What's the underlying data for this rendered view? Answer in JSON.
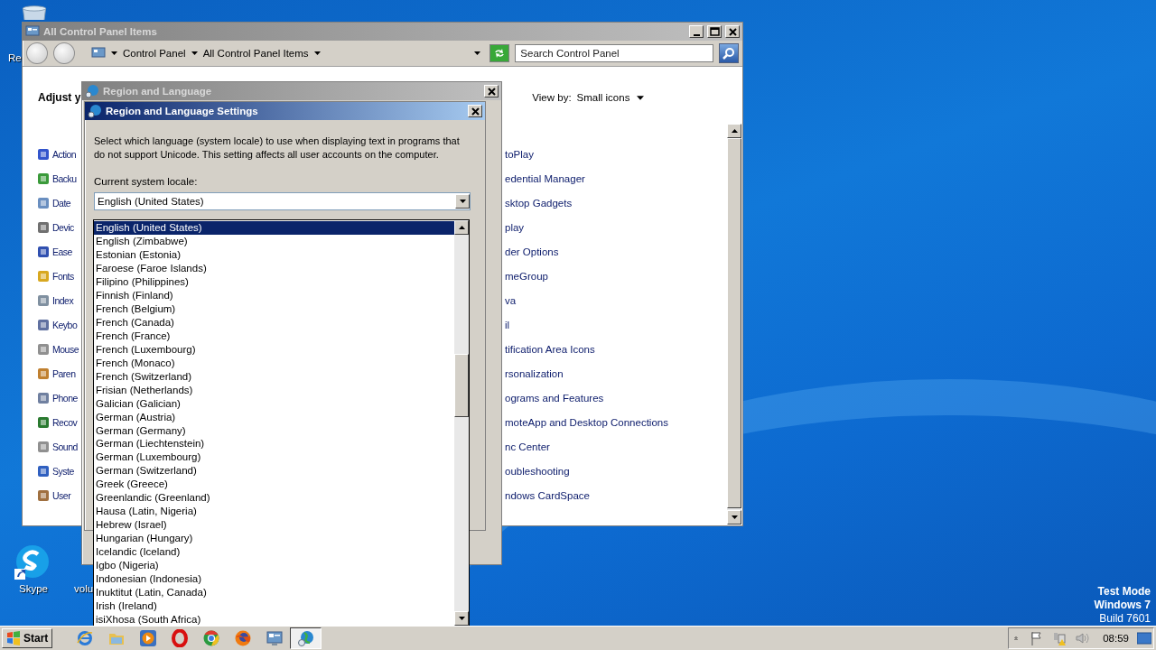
{
  "desktop": {
    "icons": [
      {
        "kind": "bin",
        "label": "Re"
      },
      {
        "kind": "skype",
        "label": "Skype"
      },
      {
        "kind": "file",
        "label": "volu"
      }
    ],
    "system_info": [
      "Test Mode",
      "Windows 7",
      "Build 7601"
    ]
  },
  "explorer": {
    "title": "All Control Panel Items",
    "breadcrumbs": [
      "Control Panel",
      "All Control Panel Items"
    ],
    "search": {
      "placeholder": "Search Control Panel"
    },
    "heading": "Adjust y",
    "view_by": {
      "label": "View by:",
      "value": "Small icons"
    },
    "left_items": [
      "Action",
      "Backu",
      "Date",
      "Devic",
      "Ease",
      "Fonts",
      "Index",
      "Keybo",
      "Mouse",
      "Paren",
      "Phone",
      "Recov",
      "Sound",
      "Syste",
      "User"
    ],
    "right_items": [
      "toPlay",
      "edential Manager",
      "sktop Gadgets",
      "play",
      "der Options",
      "meGroup",
      "va",
      "il",
      "tification Area Icons",
      "rsonalization",
      "ograms and Features",
      "moteApp and Desktop Connections",
      "nc Center",
      "oubleshooting",
      "ndows CardSpace"
    ]
  },
  "region_dialog": {
    "title": "Region and Language"
  },
  "settings_dialog": {
    "title": "Region and Language Settings",
    "description": "Select which language (system locale) to use when displaying text in programs that do not support Unicode. This setting affects all user accounts on the computer.",
    "locale_label": "Current system locale:",
    "locale_value": "English (United States)",
    "options": [
      {
        "label": "English (United States)",
        "selected": true
      },
      {
        "label": "English (Zimbabwe)",
        "selected": false
      },
      {
        "label": "Estonian (Estonia)",
        "selected": false
      },
      {
        "label": "Faroese (Faroe Islands)",
        "selected": false
      },
      {
        "label": "Filipino (Philippines)",
        "selected": false
      },
      {
        "label": "Finnish (Finland)",
        "selected": false
      },
      {
        "label": "French (Belgium)",
        "selected": false
      },
      {
        "label": "French (Canada)",
        "selected": false
      },
      {
        "label": "French (France)",
        "selected": false
      },
      {
        "label": "French (Luxembourg)",
        "selected": false
      },
      {
        "label": "French (Monaco)",
        "selected": false
      },
      {
        "label": "French (Switzerland)",
        "selected": false
      },
      {
        "label": "Frisian (Netherlands)",
        "selected": false
      },
      {
        "label": "Galician (Galician)",
        "selected": false
      },
      {
        "label": "German (Austria)",
        "selected": false
      },
      {
        "label": "German (Germany)",
        "selected": false
      },
      {
        "label": "German (Liechtenstein)",
        "selected": false
      },
      {
        "label": "German (Luxembourg)",
        "selected": false
      },
      {
        "label": "German (Switzerland)",
        "selected": false
      },
      {
        "label": "Greek (Greece)",
        "selected": false
      },
      {
        "label": "Greenlandic (Greenland)",
        "selected": false
      },
      {
        "label": "Hausa (Latin, Nigeria)",
        "selected": false
      },
      {
        "label": "Hebrew (Israel)",
        "selected": false
      },
      {
        "label": "Hungarian (Hungary)",
        "selected": false
      },
      {
        "label": "Icelandic (Iceland)",
        "selected": false
      },
      {
        "label": "Igbo (Nigeria)",
        "selected": false
      },
      {
        "label": "Indonesian (Indonesia)",
        "selected": false
      },
      {
        "label": "Inuktitut (Latin, Canada)",
        "selected": false
      },
      {
        "label": "Irish (Ireland)",
        "selected": false
      },
      {
        "label": "isiXhosa (South Africa)",
        "selected": false
      }
    ]
  },
  "taskbar": {
    "start": "Start",
    "apps": [
      {
        "kind": "ie",
        "selected": false
      },
      {
        "kind": "folder",
        "selected": false
      },
      {
        "kind": "media",
        "selected": false
      },
      {
        "kind": "opera",
        "selected": false
      },
      {
        "kind": "chrome",
        "selected": false
      },
      {
        "kind": "firefox",
        "selected": false
      },
      {
        "kind": "control",
        "selected": false
      },
      {
        "kind": "globe",
        "selected": true
      }
    ],
    "clock": "08:59"
  }
}
